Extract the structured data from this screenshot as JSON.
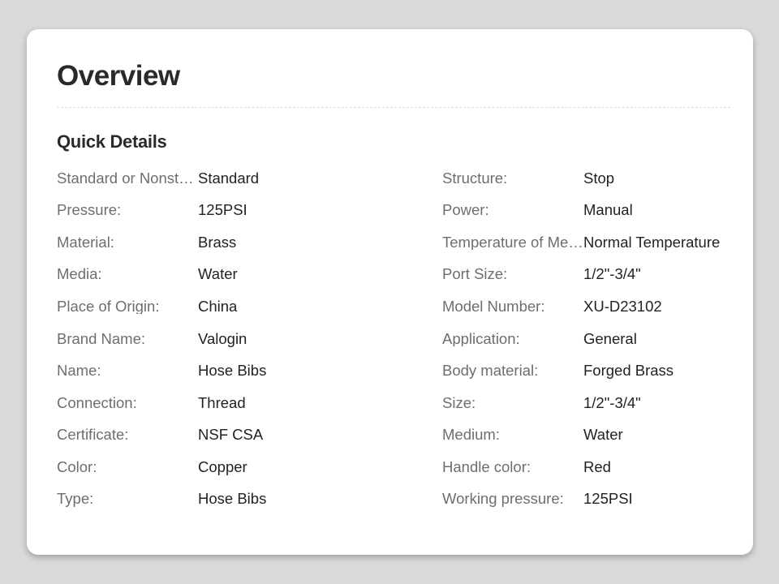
{
  "page": {
    "title": "Overview",
    "section_title": "Quick Details"
  },
  "details": {
    "left": [
      {
        "label": "Standard or Nonstandard:",
        "value": "Standard"
      },
      {
        "label": "Pressure:",
        "value": "125PSI"
      },
      {
        "label": "Material:",
        "value": "Brass"
      },
      {
        "label": "Media:",
        "value": "Water"
      },
      {
        "label": "Place of Origin:",
        "value": "China"
      },
      {
        "label": "Brand Name:",
        "value": "Valogin"
      },
      {
        "label": "Name:",
        "value": "Hose Bibs"
      },
      {
        "label": "Connection:",
        "value": "Thread"
      },
      {
        "label": "Certificate:",
        "value": "NSF CSA"
      },
      {
        "label": "Color:",
        "value": "Copper"
      },
      {
        "label": "Type:",
        "value": "Hose Bibs"
      }
    ],
    "right": [
      {
        "label": "Structure:",
        "value": "Stop"
      },
      {
        "label": "Power:",
        "value": "Manual"
      },
      {
        "label": "Temperature of Media:",
        "value": "Normal Temperature"
      },
      {
        "label": "Port Size:",
        "value": "1/2\"-3/4\""
      },
      {
        "label": "Model Number:",
        "value": "XU-D23102"
      },
      {
        "label": "Application:",
        "value": "General"
      },
      {
        "label": "Body material:",
        "value": "Forged Brass"
      },
      {
        "label": "Size:",
        "value": "1/2\"-3/4\""
      },
      {
        "label": "Medium:",
        "value": "Water"
      },
      {
        "label": "Handle color:",
        "value": "Red"
      },
      {
        "label": "Working pressure:",
        "value": "125PSI"
      }
    ]
  }
}
